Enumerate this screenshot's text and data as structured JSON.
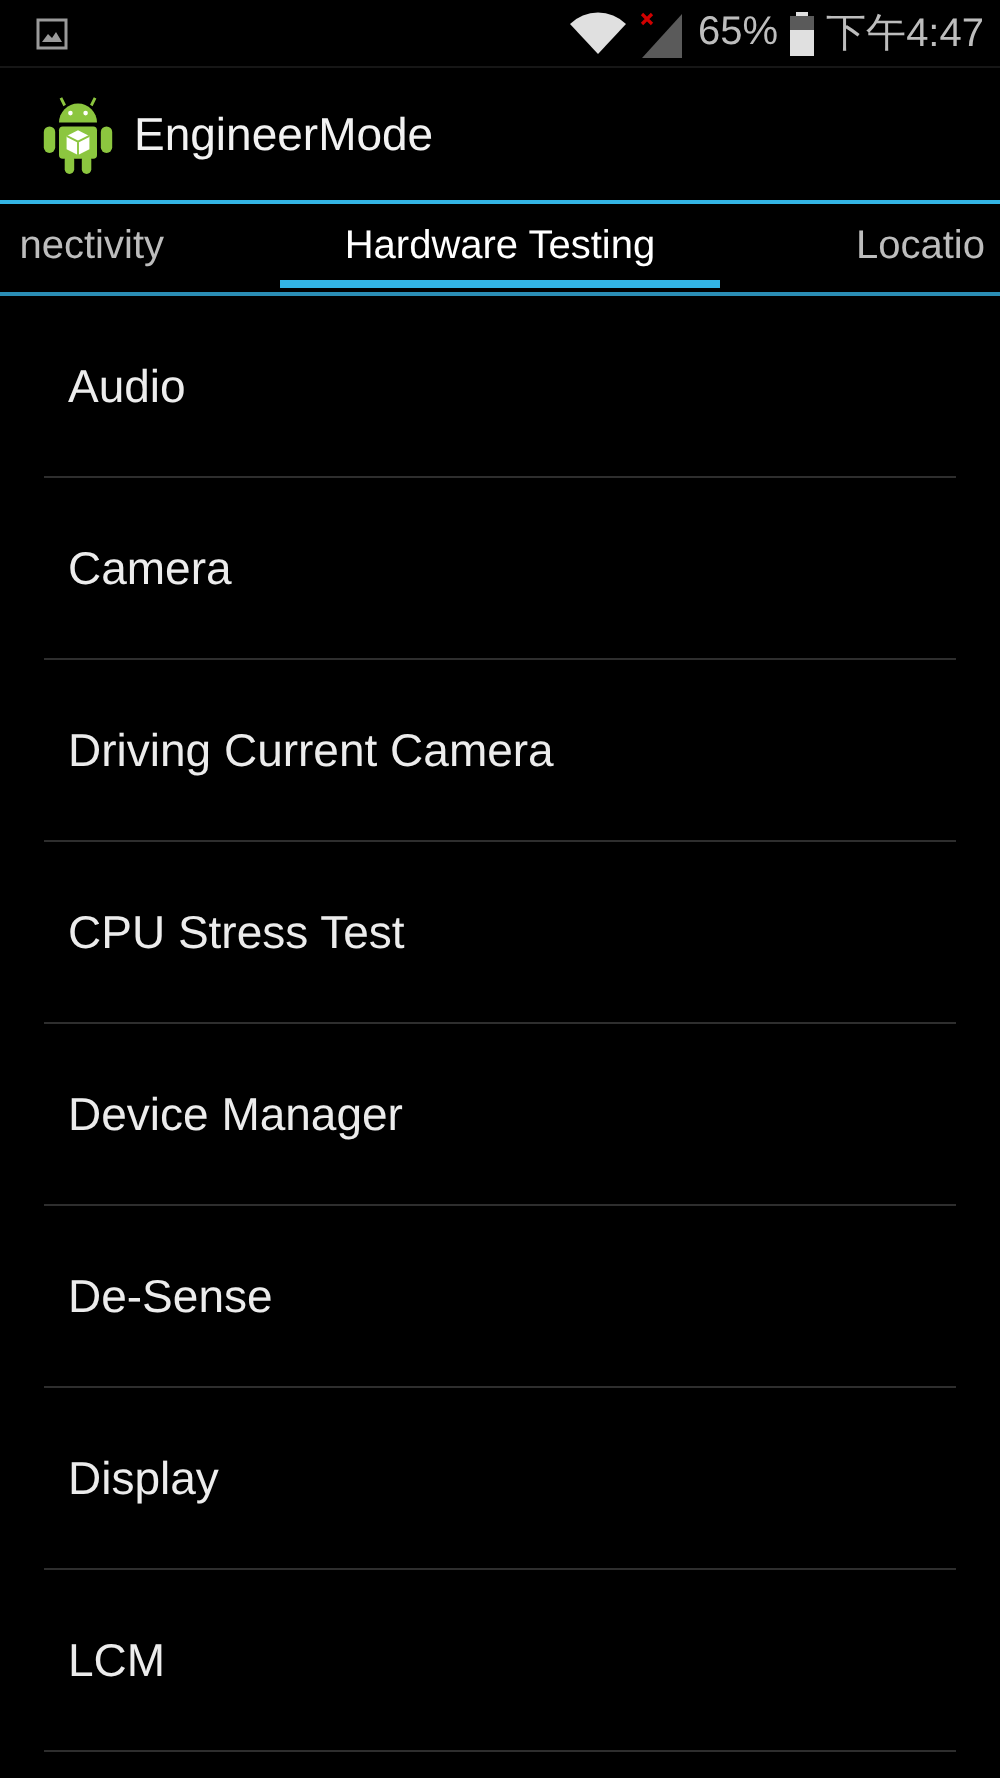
{
  "status_bar": {
    "battery": "65%",
    "time": "下午4:47"
  },
  "action_bar": {
    "title": "EngineerMode"
  },
  "tabs": [
    {
      "label": "nectivity",
      "selected": false
    },
    {
      "label": "Hardware Testing",
      "selected": true
    },
    {
      "label": "Locatio",
      "selected": false
    }
  ],
  "items": [
    "Audio",
    "Camera",
    "Driving Current Camera",
    "CPU Stress Test",
    "Device Manager",
    "De-Sense",
    "Display",
    "LCM"
  ]
}
